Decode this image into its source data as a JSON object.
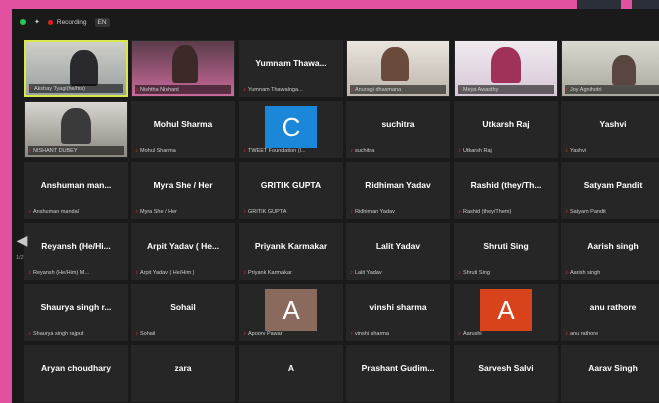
{
  "topbar": {
    "recording_label": "Recording",
    "lang_label": "EN"
  },
  "pagination": {
    "label": "1/2"
  },
  "participants": [
    {
      "name": "",
      "caption": "Akshay Tyagi(he/his)",
      "video": true,
      "active": true
    },
    {
      "name": "",
      "caption": "Nishtha Nishant",
      "video": true
    },
    {
      "name": "Yumnam Thawa...",
      "caption": "Yumnam Thawalnga..."
    },
    {
      "name": "",
      "caption": "Anuragi dhasmana",
      "video": true
    },
    {
      "name": "",
      "caption": "Meya Awasthy",
      "video": true
    },
    {
      "name": "",
      "caption": "Joy Agnihotri",
      "video": true
    },
    {
      "name": "",
      "caption": "NISHANT DUBEY",
      "video": true
    },
    {
      "name": "Mohul Sharma",
      "caption": "Mohul Sharma"
    },
    {
      "name": "",
      "caption": "TWEET Foundation (I...",
      "avatar": "C",
      "avatar_color": "#1a87d8"
    },
    {
      "name": "suchitra",
      "caption": "suchitra"
    },
    {
      "name": "Utkarsh Raj",
      "caption": "Utkarsh Raj"
    },
    {
      "name": "Yashvi",
      "caption": "Yashvi"
    },
    {
      "name": "Anshuman man...",
      "caption": "Anshuman mandal"
    },
    {
      "name": "Myra She / Her",
      "caption": "Myra She / Her"
    },
    {
      "name": "GRITIK GUPTA",
      "caption": "GRITIK GUPTA"
    },
    {
      "name": "Ridhiman Yadav",
      "caption": "Ridhiman Yadav"
    },
    {
      "name": "Rashid (they/Th...",
      "caption": "Rashid (they/Them)"
    },
    {
      "name": "Satyam Pandit",
      "caption": "Satyam Pandit"
    },
    {
      "name": "Reyansh (He/Hi...",
      "caption": "Reyansh (He/Him) M..."
    },
    {
      "name": "Arpit Yadav ( He...",
      "caption": "Arpit Yadav ( He/Him )"
    },
    {
      "name": "Priyank Karmakar",
      "caption": "Priyank Karmakar"
    },
    {
      "name": "Lalit Yadav",
      "caption": "Lalit Yadav"
    },
    {
      "name": "Shruti Sing",
      "caption": "Shruti Sing"
    },
    {
      "name": "Aarish singh",
      "caption": "Aarish singh"
    },
    {
      "name": "Shaurya singh r...",
      "caption": "Shaurya singh rajput"
    },
    {
      "name": "Sohail",
      "caption": "Sohail"
    },
    {
      "name": "",
      "caption": "Apoorv Pawar",
      "avatar": "A",
      "avatar_color": "#8a6a5c"
    },
    {
      "name": "vinshi sharma",
      "caption": "vinshi sharma"
    },
    {
      "name": "",
      "caption": "Aarushi",
      "avatar": "A",
      "avatar_color": "#d8431b"
    },
    {
      "name": "anu rathore",
      "caption": "anu rathore"
    },
    {
      "name": "Aryan choudhary",
      "caption": ""
    },
    {
      "name": "zara",
      "caption": ""
    },
    {
      "name": "A",
      "caption": ""
    },
    {
      "name": "Prashant Gudim...",
      "caption": ""
    },
    {
      "name": "Sarvesh Salvi",
      "caption": ""
    },
    {
      "name": "Aarav Singh",
      "caption": ""
    }
  ],
  "colors": {
    "background": "#e2519f",
    "window": "#1a1a1a",
    "tile": "#262626",
    "active_border": "#d6e84a",
    "muted_mic": "#e23030"
  }
}
